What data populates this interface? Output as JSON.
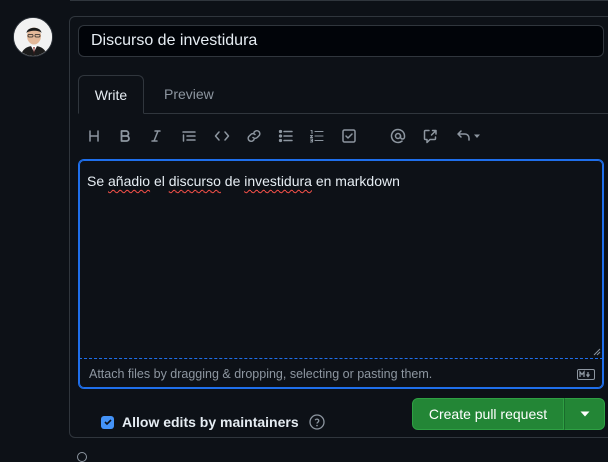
{
  "pr_form": {
    "title_value": "Discurso de investidura",
    "tabs": [
      {
        "label": "Write",
        "active": true
      },
      {
        "label": "Preview",
        "active": false
      }
    ],
    "toolbar_icons": [
      "heading-icon",
      "bold-icon",
      "italic-icon",
      "quote-icon",
      "code-icon",
      "link-icon",
      "unordered-list-icon",
      "ordered-list-icon",
      "task-list-icon",
      "mention-icon",
      "cross-reference-icon",
      "undo-icon"
    ],
    "body": {
      "prefix": "Se ",
      "word1": "añadio",
      "middle": " el ",
      "word2": "discurso",
      "between": " de ",
      "word3": "investidura",
      "suffix": " en markdown"
    },
    "attach_hint": "Attach files by dragging & dropping, selecting or pasting them.",
    "allow_edits_label": "Allow edits by maintainers",
    "allow_edits_checked": true,
    "submit_label": "Create pull request"
  },
  "colors": {
    "background": "#0d1117",
    "border": "#30363d",
    "focus": "#1f6feb",
    "primary_button": "#238636",
    "checkbox": "#4493f8",
    "muted_text": "#8d96a0"
  }
}
